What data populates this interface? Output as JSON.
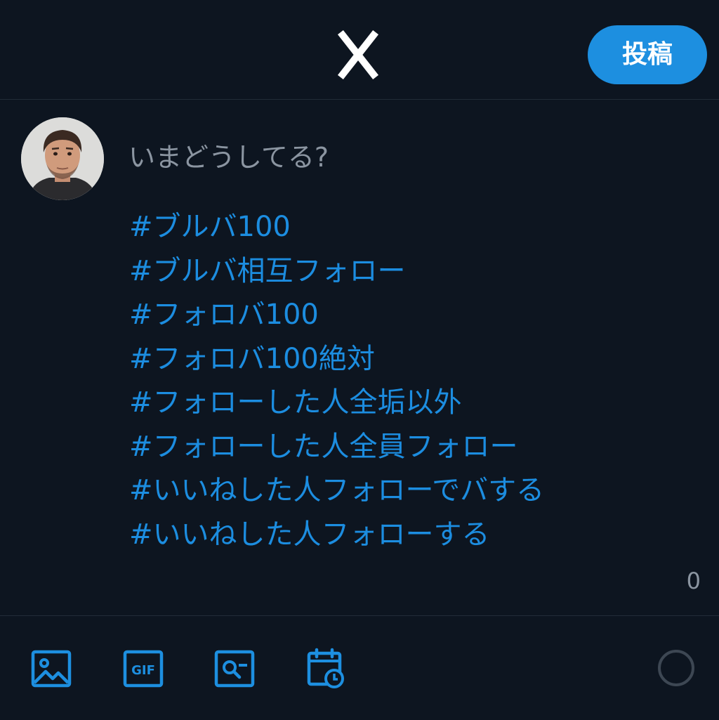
{
  "header": {
    "logo_icon": "x-logo-icon",
    "post_label": "投稿"
  },
  "compose": {
    "avatar_icon": "user-avatar",
    "placeholder": "いまどうしてる?",
    "hashtags": [
      "#ブルバ100",
      "#ブルバ相互フォロー",
      "#フォロバ100",
      "#フォロバ100絶対",
      "#フォローした人全垢以外",
      "#フォローした人全員フォロー",
      "#いいねした人フォローでバする",
      "#いいねした人フォローする"
    ],
    "char_count": "0"
  },
  "toolbar": {
    "icons": [
      "image-icon",
      "gif-icon",
      "search-icon",
      "schedule-icon",
      "progress-ring-icon"
    ]
  },
  "colors": {
    "background": "#0d1520",
    "accent": "#1d8fe0",
    "hashtag": "#1c8de0",
    "muted": "#8b95a1",
    "divider": "#222c38"
  }
}
